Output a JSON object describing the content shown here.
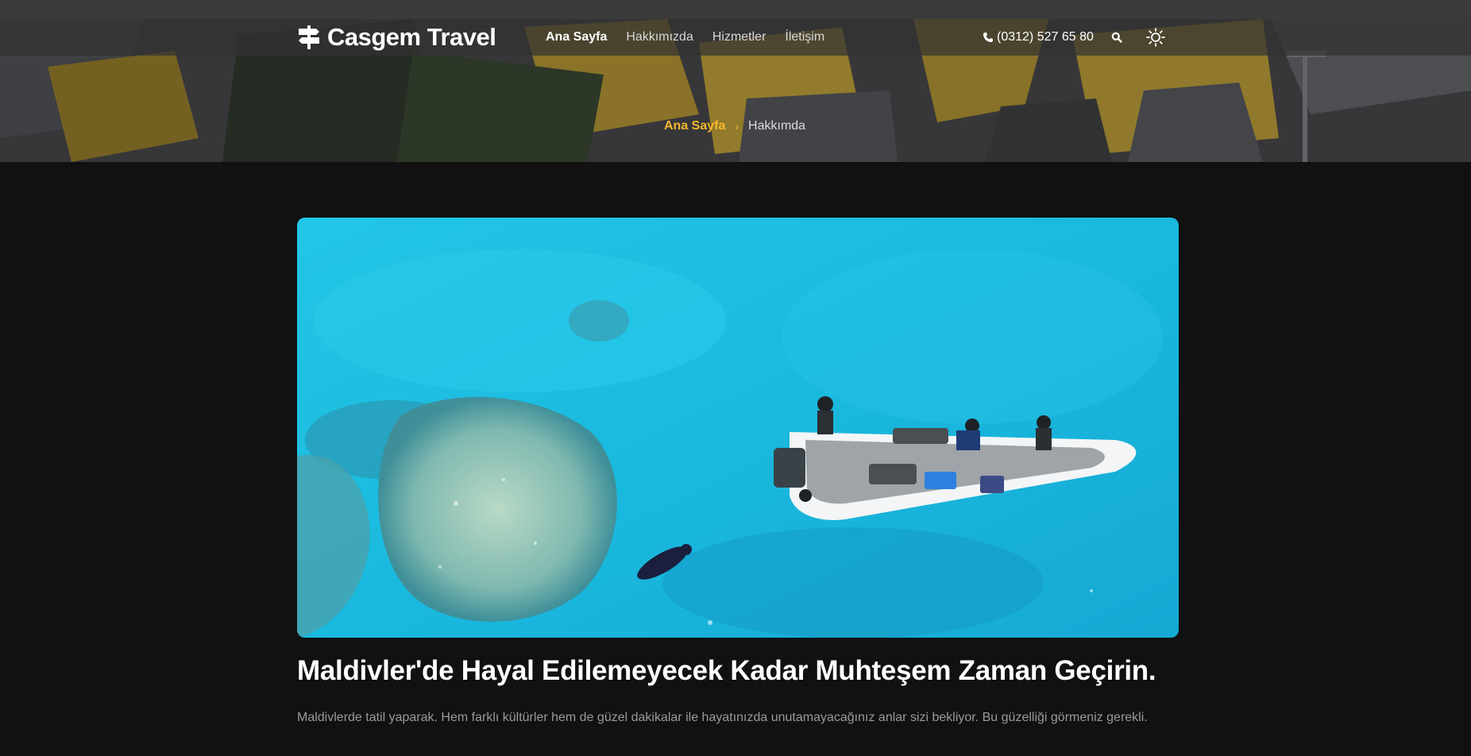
{
  "brand": {
    "name": "Casgem Travel",
    "logo_icon": "signpost-icon"
  },
  "nav": {
    "items": [
      {
        "label": "Ana Sayfa",
        "active": true
      },
      {
        "label": "Hakkımızda",
        "active": false
      },
      {
        "label": "Hizmetler",
        "active": false
      },
      {
        "label": "İletişim",
        "active": false
      }
    ]
  },
  "toolbar": {
    "phone": "(0312) 527 65 80",
    "phone_icon": "phone-icon",
    "search_icon": "search-icon",
    "theme_icon": "sun-icon"
  },
  "breadcrumb": {
    "home": "Ana Sayfa",
    "separator": "›",
    "current": "Hakkımda"
  },
  "article": {
    "title": "Maldivler'de Hayal Edilemeyecek Kadar Muhteşem Zaman Geçirin.",
    "description": "Maldivlerde tatil yaparak. Hem farklı kültürler hem de güzel dakikalar ile hayatınızda unutamayacağınız anlar sizi bekliyor. Bu güzelliği görmeniz gerekli."
  },
  "colors": {
    "accent": "#f5b82e",
    "page_bg": "#111111",
    "water": "#1fc3e3"
  }
}
